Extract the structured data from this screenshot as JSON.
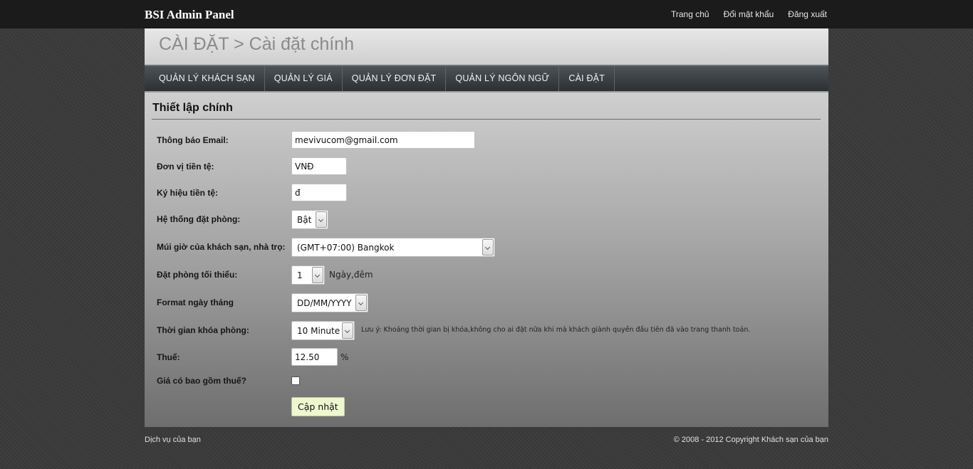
{
  "topbar": {
    "brand": "BSI Admin Panel",
    "links": [
      "Trang chủ",
      "Đổi mật khẩu",
      "Đăng xuất"
    ]
  },
  "header": {
    "title": "CÀI ĐẶT > Cài đặt chính"
  },
  "nav": [
    "QUẢN LÝ KHÁCH SẠN",
    "QUẢN LÝ GIÁ",
    "QUẢN LÝ ĐƠN ĐẶT",
    "QUẢN LÝ NGÔN NGỮ",
    "CÀI ĐẶT"
  ],
  "form": {
    "section_title": "Thiết lập chính",
    "email": {
      "label": "Thông báo Email:",
      "value": "mevivucom@gmail.com"
    },
    "currency_unit": {
      "label": "Đơn vị tiền tệ:",
      "value": "VNĐ"
    },
    "currency_symbol": {
      "label": "Ký hiệu tiền tệ:",
      "value": "đ"
    },
    "booking_system": {
      "label": "Hệ thống đặt phòng:",
      "value": "Bật"
    },
    "timezone": {
      "label": "Múi giờ của khách sạn, nhà trọ:",
      "value": "(GMT+07:00) Bangkok"
    },
    "min_booking": {
      "label": "Đặt phòng tối thiểu:",
      "value": "1",
      "suffix": "Ngày,đêm"
    },
    "date_format": {
      "label": "Format ngày tháng",
      "value": "DD/MM/YYYY"
    },
    "lock_time": {
      "label": "Thời gian khóa phòng:",
      "value": "10 Minute",
      "note": "Lưu ý: Khoảng thời gian bị khóa,không cho ai đặt nữa khi mà khách giành quyền đầu tiên đã vào trang thanh toán."
    },
    "tax": {
      "label": "Thuế:",
      "value": "12.50",
      "suffix": "%"
    },
    "price_includes_tax": {
      "label": "Giá có bao gồm thuế?",
      "checked": false
    },
    "submit_label": "Cập nhật"
  },
  "footer": {
    "left": "Dịch vụ của bạn",
    "right": "© 2008 - 2012 Copyright Khách sạn của bạn"
  }
}
